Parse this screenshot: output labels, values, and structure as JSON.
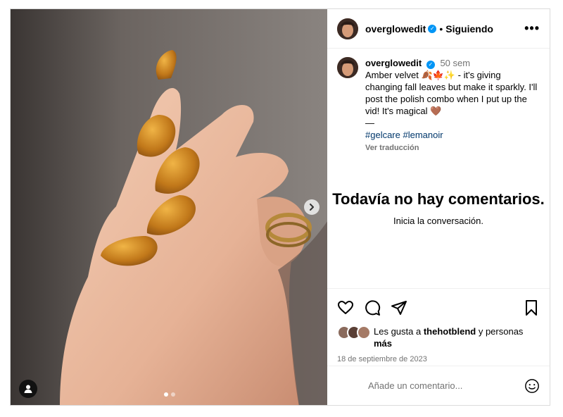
{
  "header": {
    "username": "overglowedit",
    "separator": "•",
    "follow_status": "Siguiendo",
    "more_icon": "more-options-icon"
  },
  "caption": {
    "username": "overglowedit",
    "time": "50 sem",
    "text_line": "Amber velvet 🍂🍁✨ - it's giving changing fall leaves but make it sparkly. I'll post the polish combo when I put up the vid! It's magical 🤎",
    "divider": "—",
    "tags": "#gelcare #lemanoir",
    "translate": "Ver traducción"
  },
  "comments": {
    "empty_title": "Todavía no hay comentarios.",
    "empty_subtitle": "Inicia la conversación."
  },
  "likes": {
    "prefix": "Les gusta a ",
    "user": "thehotblend",
    "suffix": " y personas",
    "more": "más"
  },
  "date": "18 de septiembre de 2023",
  "comment_box": {
    "placeholder": "Añade un comentario..."
  },
  "icons": {
    "like": "heart-icon",
    "comment": "comment-icon",
    "share": "share-icon",
    "save": "bookmark-icon",
    "emoji": "emoji-icon",
    "next": "chevron-right-icon",
    "tagged": "user-tag-icon"
  },
  "carousel": {
    "total": 2,
    "active": 1
  },
  "colors": {
    "verified": "#0095f6",
    "link": "#00376b",
    "muted": "#737373"
  }
}
